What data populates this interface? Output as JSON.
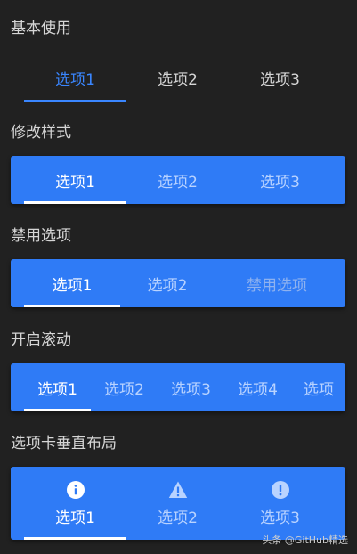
{
  "sections": [
    {
      "title": "基本使用",
      "tabs": [
        "选项1",
        "选项2",
        "选项3"
      ],
      "active": "选项1"
    },
    {
      "title": "修改样式",
      "tabs": [
        "选项1",
        "选项2",
        "选项3"
      ],
      "active": "选项1"
    },
    {
      "title": "禁用选项",
      "tabs": [
        "选项1",
        "选项2",
        "禁用选项"
      ],
      "active": "选项1",
      "disabled": "禁用选项"
    },
    {
      "title": "开启滚动",
      "tabs": [
        "选项1",
        "选项2",
        "选项3",
        "选项4",
        "选项"
      ],
      "active": "选项1"
    },
    {
      "title": "选项卡垂直布局",
      "tabs": [
        {
          "label": "选项1",
          "icon": "info-icon"
        },
        {
          "label": "选项2",
          "icon": "warning-icon"
        },
        {
          "label": "选项3",
          "icon": "error-icon"
        }
      ],
      "active": "选项1"
    }
  ],
  "colors": {
    "background": "#212121",
    "bar": "#2f7bf6",
    "accent": "#3a86ff",
    "text": "#d6d6d6"
  },
  "watermark": "头条 @GitHub精选"
}
